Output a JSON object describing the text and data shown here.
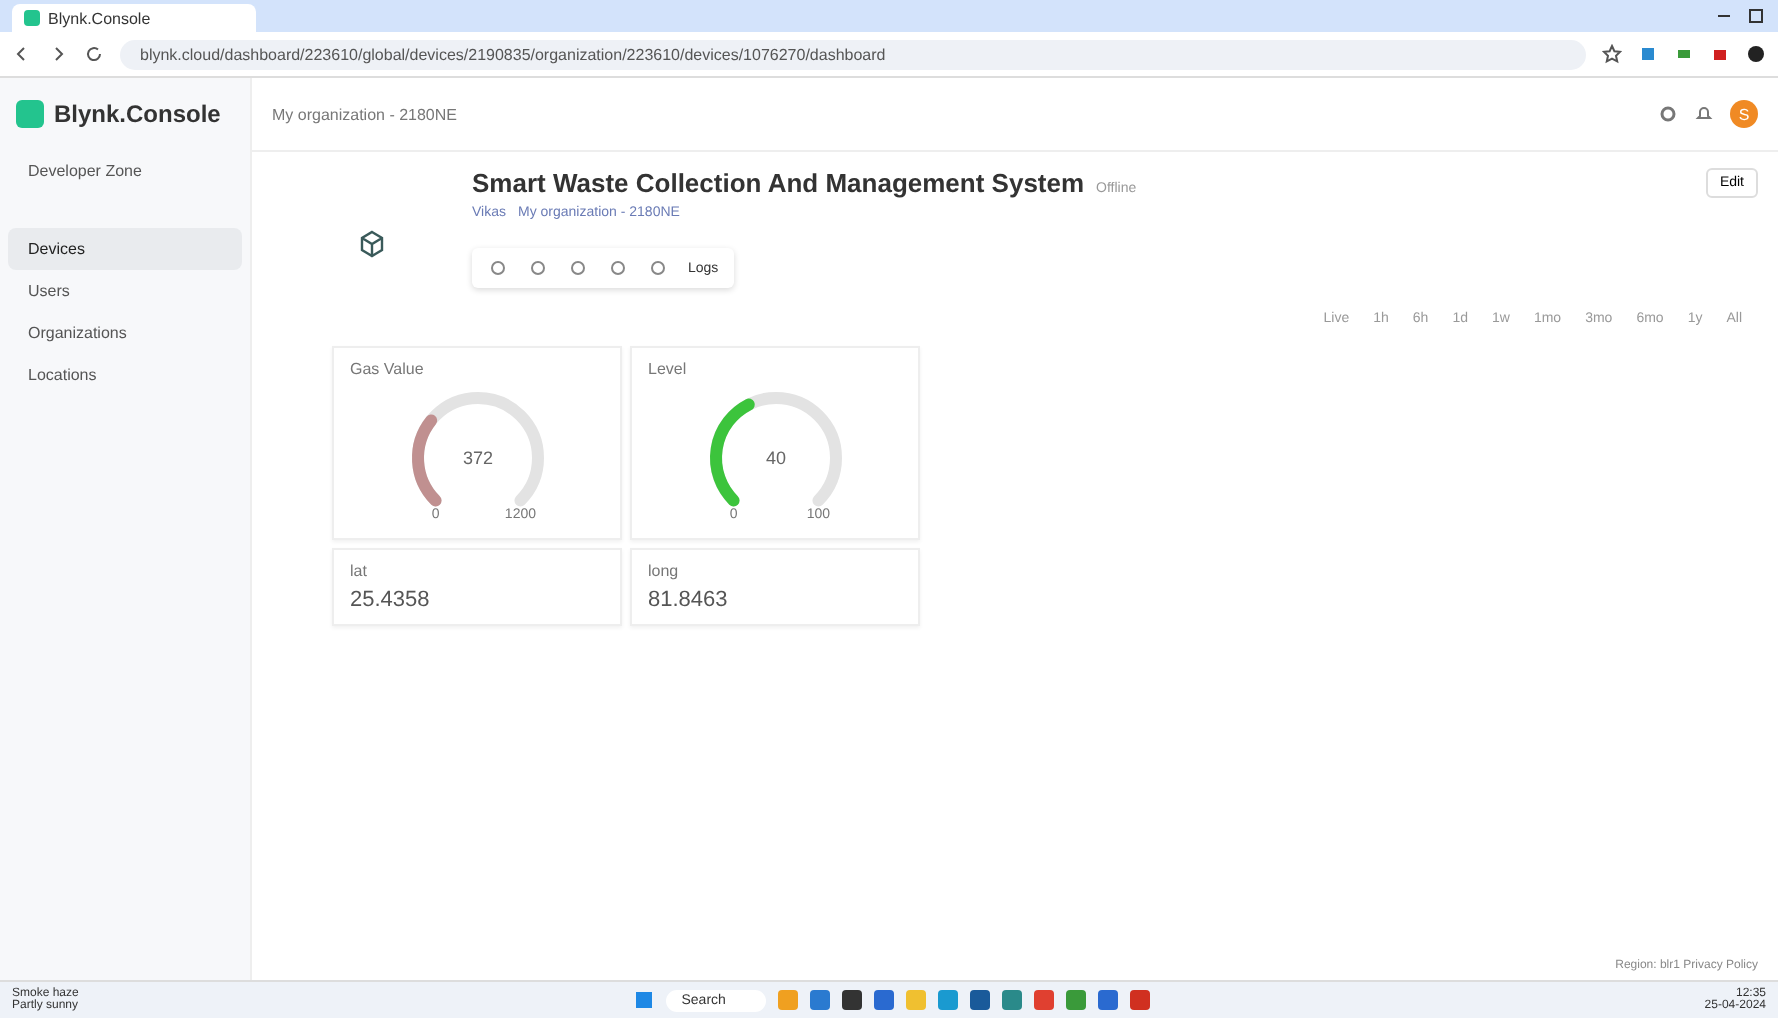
{
  "browser": {
    "tab_title": "Blynk.Console",
    "url": "blynk.cloud/dashboard/223610/global/devices/2190835/organization/223610/devices/1076270/dashboard"
  },
  "header": {
    "brand": "Blynk.Console",
    "breadcrumb": "My organization - 2180NE",
    "avatar": "S"
  },
  "sidebar": {
    "items": [
      {
        "label": "Developer Zone",
        "selected": false
      },
      {
        "label": "Devices",
        "selected": true
      },
      {
        "label": "Users",
        "selected": false
      },
      {
        "label": "Organizations",
        "selected": false
      },
      {
        "label": "Locations",
        "selected": false
      }
    ]
  },
  "device": {
    "title": "Smart Waste Collection And Management System",
    "status": "Offline",
    "owner": "Vikas",
    "organization": "My organization - 2180NE",
    "edit_button": "Edit",
    "toolbar_extra": "Logs"
  },
  "time_ranges": [
    {
      "label": "Live",
      "selected": false
    },
    {
      "label": "1h",
      "selected": false
    },
    {
      "label": "6h",
      "selected": false
    },
    {
      "label": "1d",
      "selected": false
    },
    {
      "label": "1w",
      "selected": false
    },
    {
      "label": "1mo",
      "selected": false
    },
    {
      "label": "3mo",
      "selected": false
    },
    {
      "label": "6mo",
      "selected": false
    },
    {
      "label": "1y",
      "selected": false
    },
    {
      "label": "All",
      "selected": false
    }
  ],
  "widgets": [
    {
      "kind": "gauge",
      "title": "Gas Value",
      "value": "372",
      "min": "0",
      "max": "1200",
      "color": "#c09090"
    },
    {
      "kind": "gauge",
      "title": "Level",
      "value": "40",
      "min": "0",
      "max": "100",
      "color": "#3cc43c"
    },
    {
      "kind": "label",
      "title": "lat",
      "value": "25.4358"
    },
    {
      "kind": "label",
      "title": "long",
      "value": "81.8463"
    }
  ],
  "footer": "Region: blr1  Privacy Policy",
  "taskbar": {
    "weather": "Smoke haze",
    "weather_sub": "Partly sunny",
    "search": "Search",
    "time": "12:35",
    "date": "25-04-2024"
  }
}
